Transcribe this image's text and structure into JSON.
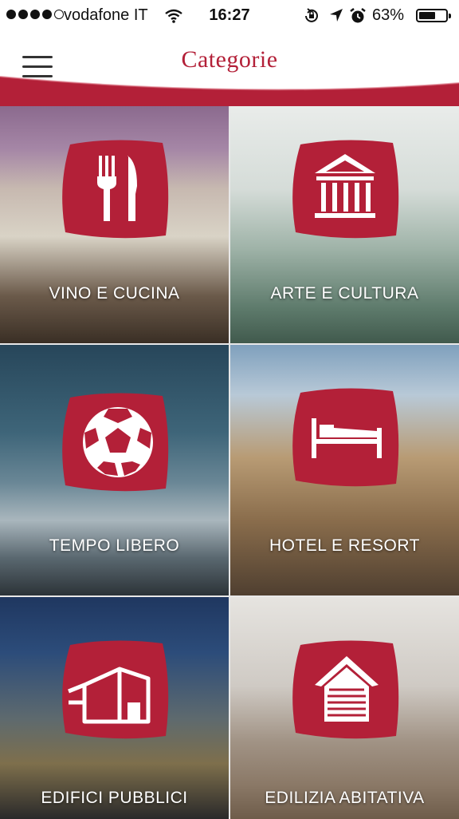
{
  "status_bar": {
    "carrier": "vodafone IT",
    "time": "16:27",
    "battery_percent": "63%",
    "battery_level": 0.63,
    "signal_bars_filled": 4,
    "signal_bars_total": 5
  },
  "nav": {
    "title": "Categorie",
    "accent_color": "#b32038"
  },
  "categories": [
    {
      "label": "VINO E CUCINA",
      "icon": "fork-knife-icon"
    },
    {
      "label": "ARTE E CULTURA",
      "icon": "museum-icon"
    },
    {
      "label": "TEMPO LIBERO",
      "icon": "soccer-ball-icon"
    },
    {
      "label": "HOTEL E RESORT",
      "icon": "bed-icon"
    },
    {
      "label": "EDIFICI PUBBLICI",
      "icon": "building-icon"
    },
    {
      "label": "EDILIZIA ABITATIVA",
      "icon": "house-icon"
    }
  ]
}
